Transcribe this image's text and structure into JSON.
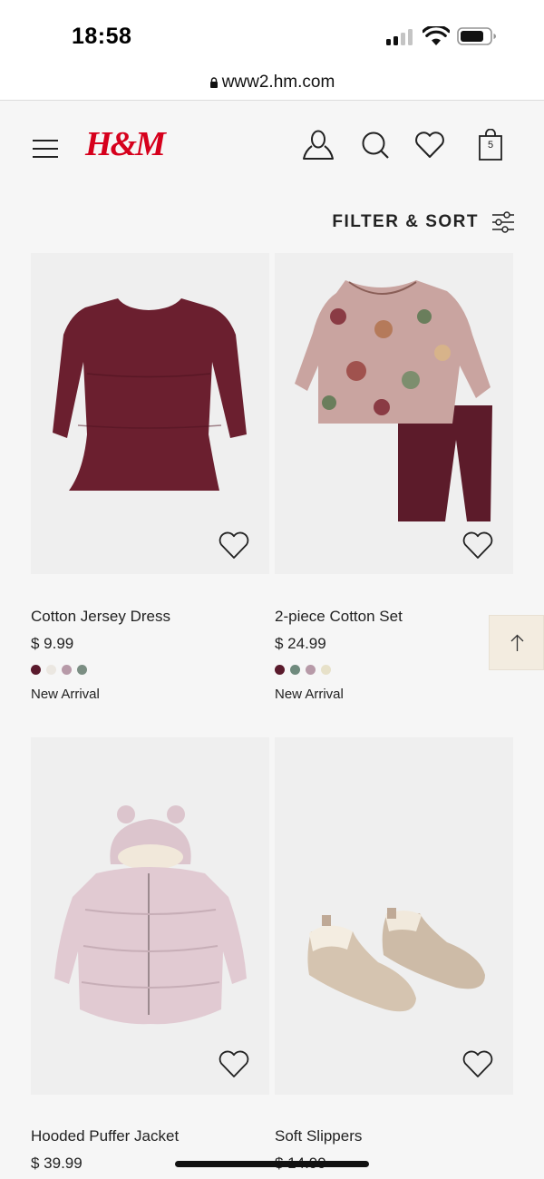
{
  "status": {
    "time": "18:58"
  },
  "browser": {
    "url": "www2.hm.com"
  },
  "header": {
    "logo_text": "H&M",
    "bag_count": "5"
  },
  "filter": {
    "label": "FILTER & SORT"
  },
  "colors": {
    "brand": "#d6001c",
    "scroll_bg": "#f3ece0"
  },
  "products": [
    {
      "name": "Cotton Jersey Dress",
      "price": "$ 9.99",
      "badge": "New Arrival",
      "swatches": [
        "#5a1a2c",
        "#ebe7e1",
        "#b79aa8",
        "#7b8e83"
      ]
    },
    {
      "name": "2-piece Cotton Set",
      "price": "$ 24.99",
      "badge": "New Arrival",
      "swatches": [
        "#5a1a2c",
        "#6f8a7d",
        "#b79aa8",
        "#e7e1c9"
      ]
    },
    {
      "name": "Hooded Puffer Jacket",
      "price": "$ 39.99",
      "badge": "",
      "swatches": []
    },
    {
      "name": "Soft Slippers",
      "price": "$ 14.99",
      "badge": "",
      "swatches": []
    }
  ]
}
